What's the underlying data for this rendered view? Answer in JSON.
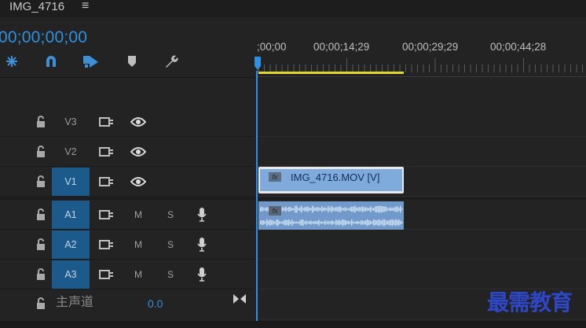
{
  "sequence": {
    "name": "IMG_4716",
    "menu_icon": "≡"
  },
  "timecode": "00;00;00;00",
  "tools": [
    {
      "name": "snap-icon"
    },
    {
      "name": "linked-selection-icon"
    },
    {
      "name": "add-marker-icon"
    },
    {
      "name": "marker-icon"
    },
    {
      "name": "settings-wrench-icon"
    }
  ],
  "ruler": {
    "ticks": [
      ";00;00",
      "00;00;14;29",
      "00;00;29;29",
      "00;00;44;28"
    ]
  },
  "video_tracks": [
    {
      "label": "V3",
      "active": false
    },
    {
      "label": "V2",
      "active": false
    },
    {
      "label": "V1",
      "active": true
    }
  ],
  "audio_tracks": [
    {
      "label": "A1",
      "mute": "M",
      "solo": "S"
    },
    {
      "label": "A2",
      "mute": "M",
      "solo": "S"
    },
    {
      "label": "A3",
      "mute": "M",
      "solo": "S"
    }
  ],
  "master": {
    "label": "主声道",
    "value": "0.0"
  },
  "clips": {
    "video": "IMG_4716.MOV [V]",
    "fx": "fx"
  },
  "watermark": "最需教育",
  "colors": {
    "accent": "#2f8fe0",
    "track_active": "#1d5a8c",
    "clip_video": "#7faadc",
    "clip_audio": "#7199c9",
    "workarea": "#e0d82a"
  }
}
